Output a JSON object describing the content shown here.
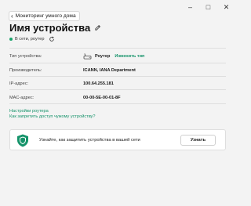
{
  "window": {
    "minimize": "–",
    "maximize": "□",
    "close": "✕"
  },
  "back_button": {
    "chevron": "‹",
    "label": "Мониторинг умного дома"
  },
  "title": "Имя устройства",
  "status": {
    "text": "В сети, роутер",
    "color": "#1aa36b"
  },
  "details": {
    "device_type": {
      "label": "Тип устройства:",
      "value": "Роутер",
      "action": "Изменить тип",
      "icon": "router-icon"
    },
    "manufacturer": {
      "label": "Производитель:",
      "value": "ICANN, IANA Department"
    },
    "ip": {
      "label": "IP-адрес:",
      "value": "100.64.255.181"
    },
    "mac": {
      "label": "MAC-адрес:",
      "value": "00-00-5E-00-01-8F"
    }
  },
  "links": {
    "router_settings": "Настройки роутера",
    "block_access": "Как запретить доступ чужому устройству?"
  },
  "banner": {
    "text": "Узнайте, как защитить устройства в вашей сети",
    "button": "Узнать",
    "icon": "shield-icon",
    "accent": "#15936a"
  }
}
